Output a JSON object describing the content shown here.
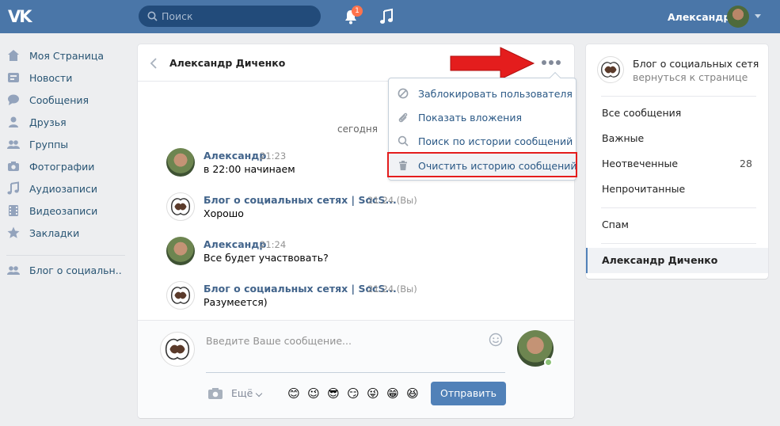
{
  "header": {
    "logo": "VK",
    "search_placeholder": "Поиск",
    "notifications_count": "1",
    "user_name": "Александр"
  },
  "sidebar": {
    "items": [
      {
        "label": "Моя Страница",
        "icon": "home-icon"
      },
      {
        "label": "Новости",
        "icon": "news-icon"
      },
      {
        "label": "Сообщения",
        "icon": "messages-icon"
      },
      {
        "label": "Друзья",
        "icon": "friends-icon"
      },
      {
        "label": "Группы",
        "icon": "groups-icon"
      },
      {
        "label": "Фотографии",
        "icon": "camera-icon"
      },
      {
        "label": "Аудиозаписи",
        "icon": "music-note-icon"
      },
      {
        "label": "Видеозаписи",
        "icon": "film-icon"
      },
      {
        "label": "Закладки",
        "icon": "star-icon"
      }
    ],
    "extra_items": [
      {
        "label": "Блог о социальн..",
        "icon": "group-icon"
      }
    ]
  },
  "dialog": {
    "title": "Александр Диченко",
    "day_separator": "сегодня",
    "messages": [
      {
        "author": "Александр",
        "time": "21:23",
        "text": "в 22:00 начинаем",
        "avatar": "alex"
      },
      {
        "author": "Блог о социальных сетях | SocS...",
        "time": "21:24 (Вы)",
        "text": "Хорошо",
        "avatar": "blog"
      },
      {
        "author": "Александр",
        "time": "21:24",
        "text": "Все будет участвовать?",
        "avatar": "alex"
      },
      {
        "author": "Блог о социальных сетях | SocS...",
        "time": "21:24 (Вы)",
        "text": "Разумеется)",
        "avatar": "blog"
      }
    ],
    "composer": {
      "placeholder": "Введите Ваше сообщение...",
      "more_label": "Ещё",
      "send_label": "Отправить",
      "emojis": [
        "😊",
        "😉",
        "😎",
        "😏",
        "😜",
        "😁",
        "😆"
      ]
    },
    "actions_menu": {
      "items": [
        {
          "label": "Заблокировать пользователя",
          "icon": "block-icon"
        },
        {
          "label": "Показать вложения",
          "icon": "paperclip-icon"
        },
        {
          "label": "Поиск по истории сообщений",
          "icon": "search-icon"
        },
        {
          "label": "Очистить историю сообщений",
          "icon": "trash-icon",
          "highlighted": true
        }
      ]
    }
  },
  "right_panel": {
    "community_title": "Блог о социальных сетях",
    "community_sub": "вернуться к странице",
    "filters": [
      {
        "label": "Все сообщения"
      },
      {
        "label": "Важные"
      },
      {
        "label": "Неотвеченные",
        "count": "28"
      },
      {
        "label": "Непрочитанные"
      }
    ],
    "spam_label": "Спам",
    "active_conversation": "Александр Диченко"
  },
  "colors": {
    "header": "#4a76a8",
    "accent": "#5181b8",
    "link": "#2a5885",
    "annotation_red": "#e41d1d"
  }
}
